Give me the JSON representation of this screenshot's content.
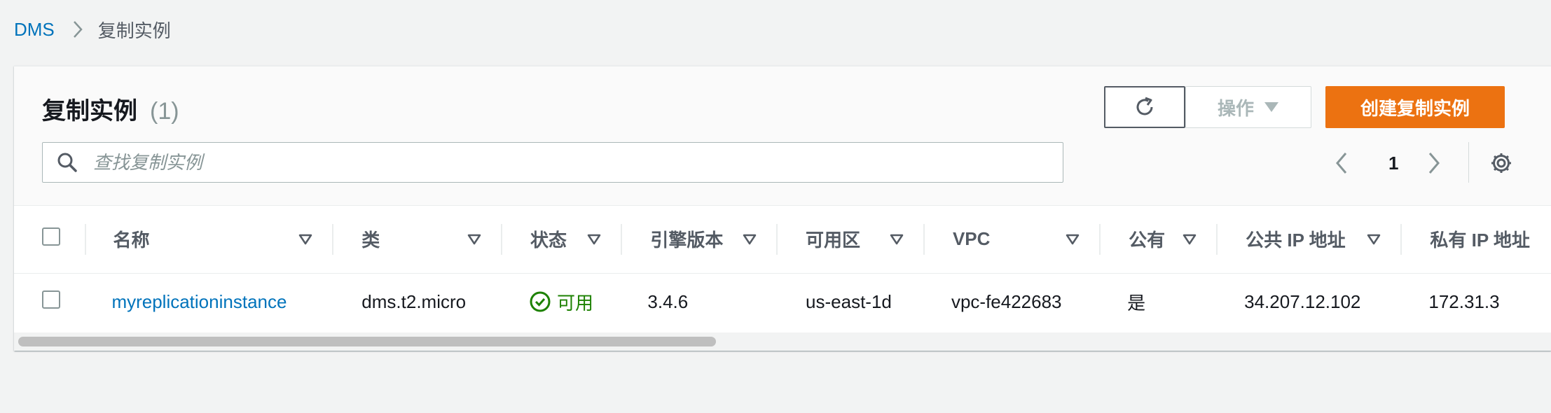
{
  "breadcrumb": {
    "root": "DMS",
    "current": "复制实例"
  },
  "header": {
    "title": "复制实例",
    "count": "(1)"
  },
  "buttons": {
    "actions": "操作",
    "create": "创建复制实例"
  },
  "search": {
    "placeholder": "查找复制实例"
  },
  "pagination": {
    "page": "1"
  },
  "table": {
    "columns": [
      "名称",
      "类",
      "状态",
      "引擎版本",
      "可用区",
      "VPC",
      "公有",
      "公共 IP 地址",
      "私有 IP 地址"
    ],
    "rows": [
      {
        "name": "myreplicationinstance",
        "class": "dms.t2.micro",
        "status": "可用",
        "engine_version": "3.4.6",
        "az": "us-east-1d",
        "vpc": "vpc-fe422683",
        "public": "是",
        "public_ip": "34.207.12.102",
        "private_ip": "172.31.3"
      }
    ]
  },
  "colors": {
    "link": "#0073bb",
    "primary": "#ec7211",
    "success": "#1d8102"
  }
}
